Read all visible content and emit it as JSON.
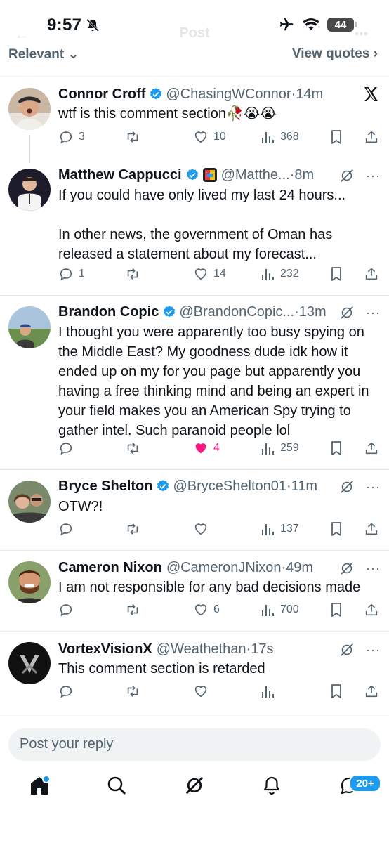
{
  "status_bar": {
    "time": "9:57",
    "battery": "44"
  },
  "header": {
    "title": "Post"
  },
  "filter": {
    "left": "Relevant",
    "right": "View quotes"
  },
  "tweets": [
    {
      "name": "Connor Croff",
      "handle": "@ChasingWConnor",
      "time": "14m",
      "text": "wtf is this comment section🥀😭😭",
      "replies": "3",
      "retweets": "",
      "likes": "10",
      "views": "368"
    },
    {
      "name": "Matthew Cappucci",
      "handle": "@Matthe...",
      "time": "8m",
      "text": "If you could have only lived my last 24 hours...\n\nIn other news, the government of Oman has released a statement about my forecast...",
      "replies": "1",
      "retweets": "",
      "likes": "14",
      "views": "232"
    },
    {
      "name": "Brandon Copic",
      "handle": "@BrandonCopic...",
      "time": "13m",
      "text": "I thought you were apparently too busy spying on the Middle East? My goodness dude idk how it ended up on my for you page but apparently you having a free thinking mind and being an expert in your field makes you an American Spy trying to gather intel. Such paranoid people lol",
      "replies": "",
      "retweets": "",
      "likes": "4",
      "views": "259"
    },
    {
      "name": "Bryce Shelton",
      "handle": "@BryceShelton01",
      "time": "11m",
      "text": "OTW?!",
      "replies": "",
      "retweets": "",
      "likes": "",
      "views": "137"
    },
    {
      "name": "Cameron Nixon",
      "handle": "@CameronJNixon",
      "time": "49m",
      "text": "I am not responsible for any bad decisions made",
      "replies": "",
      "retweets": "",
      "likes": "6",
      "views": "700"
    },
    {
      "name": "VortexVisionX",
      "handle": "@Weathethan",
      "time": "17s",
      "text": "This comment section is retarded",
      "replies": "",
      "retweets": "",
      "likes": "",
      "views": ""
    }
  ],
  "reply_input": {
    "placeholder": "Post your reply"
  },
  "nav": {
    "messages_badge": "20+"
  },
  "colors": {
    "accent": "#1d9bf0",
    "like": "#f91880",
    "muted": "#536471"
  }
}
